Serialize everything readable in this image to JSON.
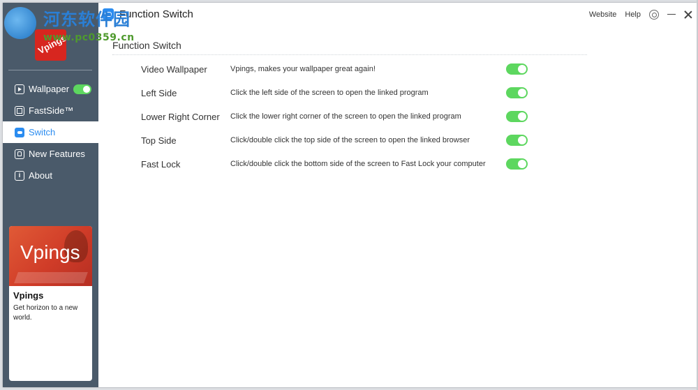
{
  "watermark": {
    "text": "河东软件园",
    "url": "www.pc0359.cn"
  },
  "app": {
    "logo_text": "Vpings",
    "window_title": "Function Switch"
  },
  "titlebar": {
    "website_label": "Website",
    "help_label": "Help"
  },
  "sidebar": {
    "items": [
      {
        "label": "Wallpaper",
        "icon": "play-icon"
      },
      {
        "label": "FastSide™",
        "icon": "square-icon"
      },
      {
        "label": "Switch",
        "icon": "switch-icon"
      },
      {
        "label": "New Features",
        "icon": "bulb-icon"
      },
      {
        "label": "About",
        "icon": "info-icon"
      }
    ],
    "active": "Switch"
  },
  "promo": {
    "image_text": "Vpings",
    "title": "Vpings",
    "description": "Get horizon to a new world."
  },
  "main": {
    "section_title": "Function Switch",
    "rows": [
      {
        "label": "Video Wallpaper",
        "description": "Vpings, makes your wallpaper great again!",
        "enabled": true
      },
      {
        "label": "Left Side",
        "description": "Click the left side of the screen to open the linked program",
        "enabled": true
      },
      {
        "label": "Lower Right Corner",
        "description": "Click the lower right corner of the screen to open the linked program",
        "enabled": true
      },
      {
        "label": "Top Side",
        "description": "Click/double click the top side of the screen to open the linked browser",
        "enabled": true
      },
      {
        "label": "Fast Lock",
        "description": "Click/double click the bottom side of the screen to Fast Lock your computer",
        "enabled": true
      }
    ]
  },
  "colors": {
    "sidebar": "#4a5a6a",
    "accent": "#2b8cf0",
    "toggle_on": "#5dd75f",
    "logo": "#d7261f"
  }
}
